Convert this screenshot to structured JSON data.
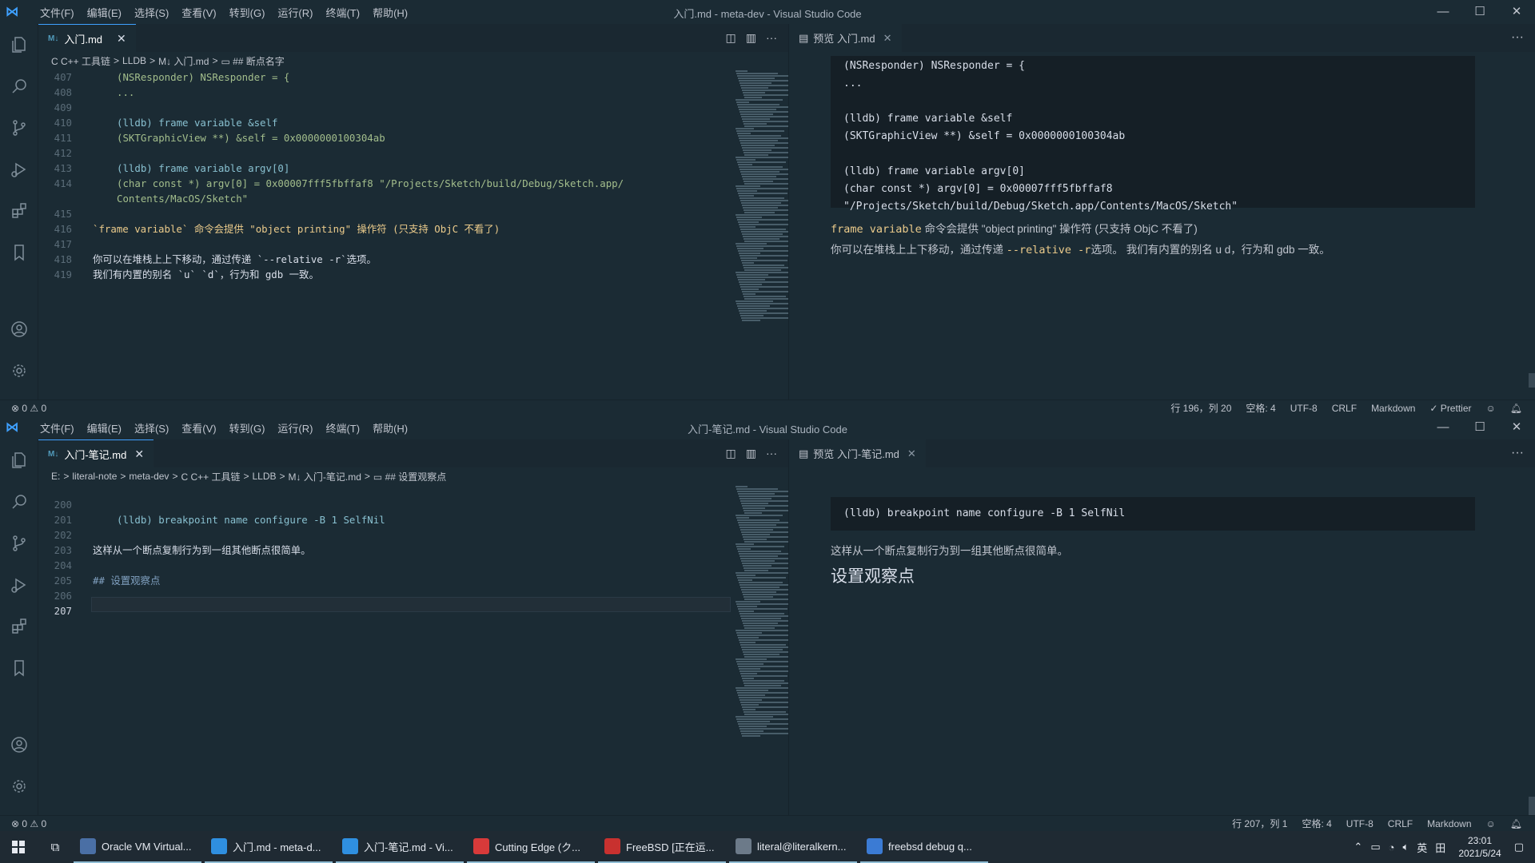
{
  "menus": [
    "文件(F)",
    "编辑(E)",
    "选择(S)",
    "查看(V)",
    "转到(G)",
    "运行(R)",
    "终端(T)",
    "帮助(H)"
  ],
  "window1": {
    "title": "入门.md - meta-dev - Visual Studio Code",
    "tab": "入门.md",
    "tab_badge": "M↓",
    "breadcrumb": [
      "C C++ 工具链",
      ">",
      "LLDB",
      ">",
      "M↓ 入门.md",
      ">",
      "▭ ## 断点名字"
    ],
    "lines": [
      {
        "n": "407",
        "t": "(NSResponder) NSResponder = {",
        "in": true
      },
      {
        "n": "408",
        "t": "...",
        "in": true
      },
      {
        "n": "409",
        "t": "",
        "in": true
      },
      {
        "n": "410",
        "t": "(lldb) frame variable &self",
        "in": true
      },
      {
        "n": "411",
        "t": "(SKTGraphicView **) &self = 0x0000000100304ab",
        "in": true
      },
      {
        "n": "412",
        "t": "",
        "in": true
      },
      {
        "n": "413",
        "t": "(lldb) frame variable argv[0]",
        "in": true
      },
      {
        "n": "414",
        "t": "(char const *) argv[0] = 0x00007fff5fbffaf8 \"/Projects/Sketch/build/Debug/Sketch.app/",
        "in": true
      },
      {
        "n": "",
        "t": "Contents/MacOS/Sketch\"",
        "in": true
      },
      {
        "n": "415",
        "t": "",
        "in": false
      },
      {
        "n": "416",
        "t": "`frame variable` 命令会提供 \"object printing\" 操作符 (只支持 ObjC 不看了)",
        "in": false
      },
      {
        "n": "417",
        "t": "",
        "in": false
      },
      {
        "n": "418",
        "t": "你可以在堆栈上上下移动，通过传递 `--relative -r`选项。",
        "in": false
      },
      {
        "n": "419",
        "t": "我们有内置的别名 `u` `d`，行为和 gdb 一致。",
        "in": false
      }
    ],
    "preview_tab": "预览 入门.md",
    "preview_code": "(NSResponder) NSResponder = {\n...\n\n(lldb) frame variable &self\n(SKTGraphicView **) &self = 0x0000000100304ab\n\n(lldb) frame variable argv[0]\n(char const *) argv[0] = 0x00007fff5fbffaf8\n\"/Projects/Sketch/build/Debug/Sketch.app/Contents/MacOS/Sketch\"",
    "preview_p1_code": "frame variable",
    "preview_p1_text": " 命令会提供 \"object printing\" 操作符 (只支持 ObjC 不看了)",
    "preview_p2_a": "你可以在堆栈上上下移动，通过传递 ",
    "preview_p2_code": "--relative -r",
    "preview_p2_b": "选项。 我们有内置的别名 u d，行为和 gdb 一致。",
    "status_left": "⊗ 0 ⚠ 0",
    "status_right": [
      "行 196，列 20",
      "空格: 4",
      "UTF-8",
      "CRLF",
      "Markdown",
      "✓ Prettier"
    ]
  },
  "window2": {
    "title": "入门-笔记.md - Visual Studio Code",
    "tab": "入门-笔记.md",
    "tab_badge": "M↓",
    "breadcrumb": [
      "E:",
      ">",
      "literal-note",
      ">",
      "meta-dev",
      ">",
      "C C++ 工具链",
      ">",
      "LLDB",
      ">",
      "M↓ 入门-笔记.md",
      ">",
      "▭ ## 设置观察点"
    ],
    "lines": [
      {
        "n": "200",
        "t": "",
        "in": false
      },
      {
        "n": "201",
        "t": "(lldb) breakpoint name configure -B 1 SelfNil",
        "in": true
      },
      {
        "n": "202",
        "t": "",
        "in": false
      },
      {
        "n": "203",
        "t": "这样从一个断点复制行为到一组其他断点很简单。",
        "in": false
      },
      {
        "n": "204",
        "t": "",
        "in": false
      },
      {
        "n": "205",
        "t": "## 设置观察点",
        "in": false
      },
      {
        "n": "206",
        "t": "",
        "in": false
      },
      {
        "n": "207",
        "t": "",
        "in": false
      }
    ],
    "preview_tab": "预览 入门-笔记.md",
    "preview_code": "(lldb) breakpoint name configure -B 1 SelfNil",
    "preview_p1": "这样从一个断点复制行为到一组其他断点很简单。",
    "preview_h2": "设置观察点",
    "status_left": "⊗ 0 ⚠ 0",
    "status_right": [
      "行 207，列 1",
      "空格: 4",
      "UTF-8",
      "CRLF",
      "Markdown"
    ]
  },
  "taskbar": {
    "items": [
      {
        "label": "Oracle VM Virtual...",
        "color": "#4a6fa5"
      },
      {
        "label": "入门.md - meta-d...",
        "color": "#2f8fe0"
      },
      {
        "label": "入门-笔记.md - Vi...",
        "color": "#2f8fe0"
      },
      {
        "label": "Cutting Edge (ク...",
        "color": "#d83a3a"
      },
      {
        "label": "FreeBSD [正在运...",
        "color": "#c8312f"
      },
      {
        "label": "literal@literalkern...",
        "color": "#6c7a89"
      },
      {
        "label": "freebsd debug q...",
        "color": "#3b7bd4"
      }
    ],
    "ime": "英",
    "ime2": "田",
    "time": "23:01",
    "date": "2021/5/24"
  }
}
